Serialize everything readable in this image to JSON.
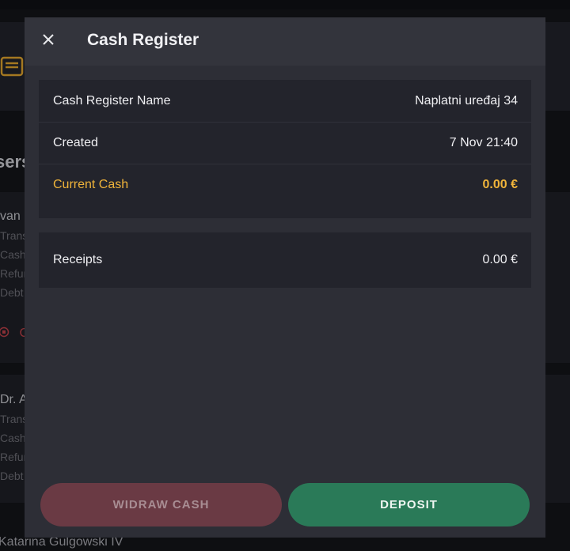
{
  "background": {
    "partial_title": "sers",
    "card1": {
      "name": "van",
      "lines": [
        "Trans",
        "Cash",
        "Refur",
        "Debt"
      ],
      "status_partial": "C"
    },
    "card2": {
      "name": "Dr. A",
      "lines": [
        "Trans",
        "Cash",
        "Refur",
        "Debt"
      ]
    },
    "bottom_name": "Katarina Gulgowski IV"
  },
  "modal": {
    "title": "Cash Register",
    "details": [
      {
        "label": "Cash Register Name",
        "value": "Naplatni uređaj 34"
      },
      {
        "label": "Created",
        "value": "7 Nov 21:40"
      },
      {
        "label": "Current Cash",
        "value": "0.00 €"
      }
    ],
    "receipts": {
      "label": "Receipts",
      "value": "0.00 €"
    },
    "buttons": {
      "withdraw": "WIDRAW CASH",
      "deposit": "DEPOSIT"
    }
  },
  "colors": {
    "accent": "#f0b43a",
    "deposit": "#2a7a58",
    "withdraw": "#6a3a44"
  }
}
